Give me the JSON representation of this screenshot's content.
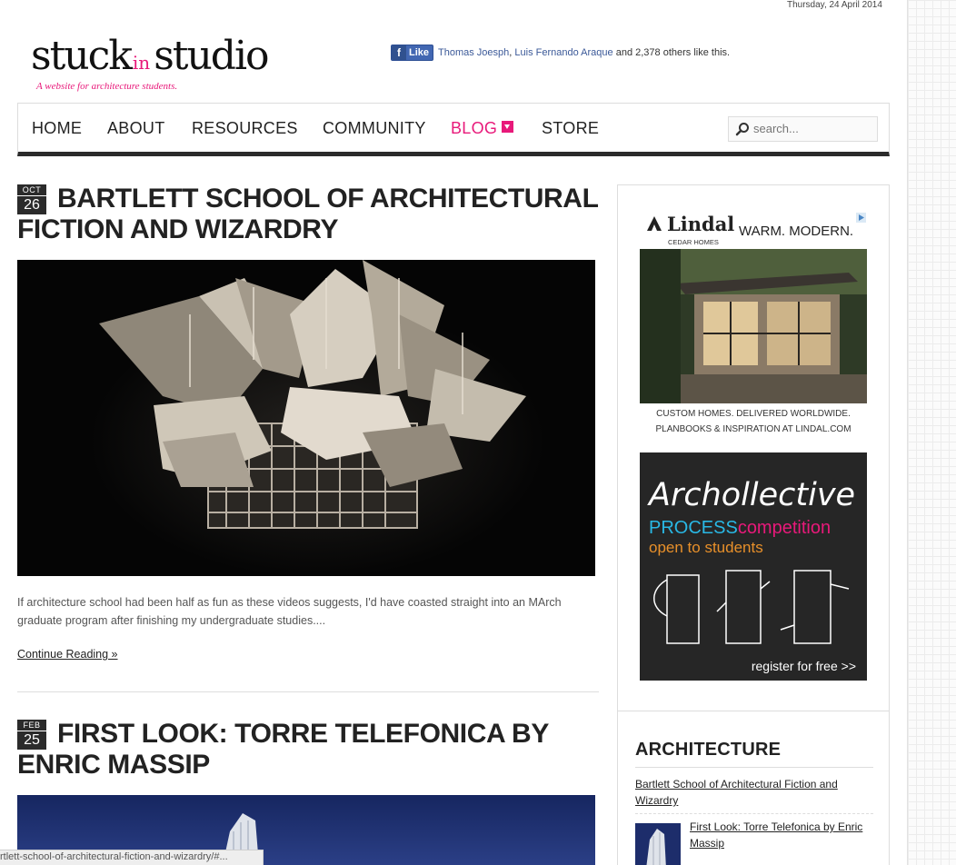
{
  "header": {
    "date": "Thursday, 24 April 2014",
    "logo_stuck": "stuck",
    "logo_in": "in",
    "logo_studio": "studio",
    "tagline": "A website for architecture students."
  },
  "facebook": {
    "like_label": "Like",
    "friend1": "Thomas Joesph",
    "separator": ", ",
    "friend2": "Luis Fernando Araque",
    "suffix": " and 2,378 others like this."
  },
  "nav": {
    "items": [
      "HOME",
      "ABOUT",
      "RESOURCES",
      "COMMUNITY",
      "BLOG",
      "STORE"
    ],
    "active": "BLOG",
    "search_placeholder": "search..."
  },
  "posts": [
    {
      "month": "OCT",
      "day": "26",
      "title": "BARTLETT SCHOOL OF ARCHITECTURAL FICTION AND WIZARDRY",
      "excerpt": "If architecture school had been half as fun as these videos suggests, I'd have coasted straight into an MArch graduate program after finishing my undergraduate studies....",
      "continue_label": "Continue Reading »"
    },
    {
      "month": "FEB",
      "day": "25",
      "title": "FIRST LOOK: TORRE TELEFONICA BY ENRIC MASSIP"
    }
  ],
  "sidebar": {
    "ad1": {
      "brand": "Lindal",
      "brand_sub": "CEDAR HOMES",
      "headline": "WARM. MODERN.",
      "caption_line1": "CUSTOM HOMES. DELIVERED WORLDWIDE.",
      "caption_line2": "PLANBOOKS & INSPIRATION AT LINDAL.COM"
    },
    "ad2": {
      "brand": "Archollective",
      "line1_a": "PROCESS",
      "line1_b": "competition",
      "line2": "open to students",
      "cta": "register for free >>"
    },
    "section_title": "ARCHITECTURE",
    "links": [
      "Bartlett School of Architectural Fiction and Wizardry",
      "First Look: Torre Telefonica by Enric Massip"
    ]
  },
  "status_bar": {
    "url": "rtlett-school-of-architectural-fiction-and-wizardry/#..."
  }
}
